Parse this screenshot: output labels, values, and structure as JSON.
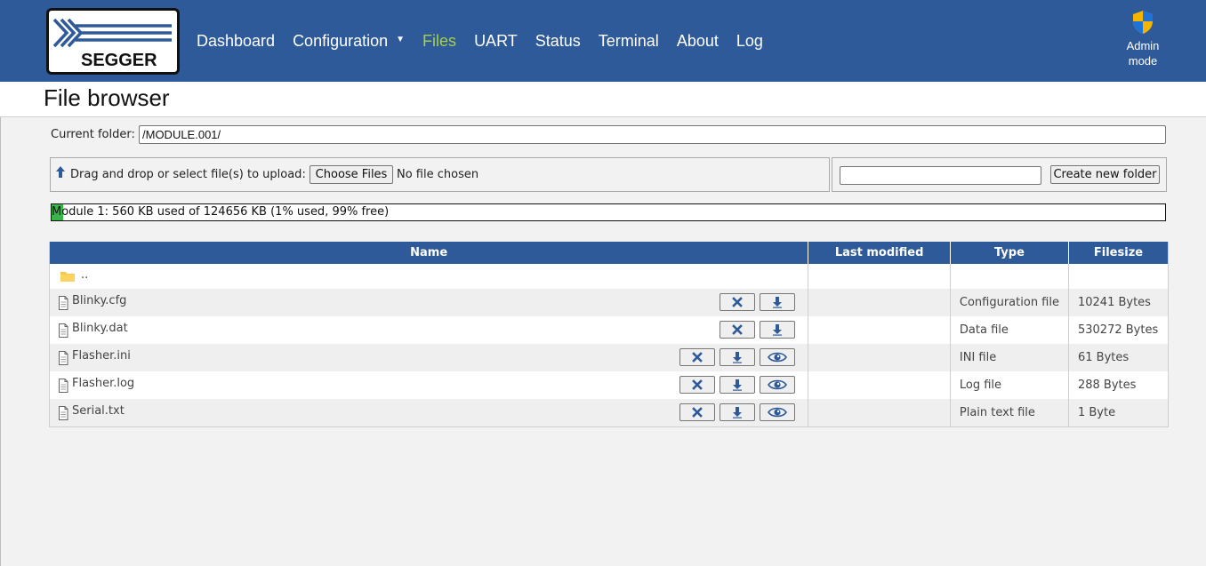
{
  "header": {
    "logo_text": "SEGGER",
    "nav": [
      {
        "label": "Dashboard",
        "active": false
      },
      {
        "label": "Configuration",
        "active": false,
        "has_dropdown": true
      },
      {
        "label": "Files",
        "active": true
      },
      {
        "label": "UART",
        "active": false
      },
      {
        "label": "Status",
        "active": false
      },
      {
        "label": "Terminal",
        "active": false
      },
      {
        "label": "About",
        "active": false
      },
      {
        "label": "Log",
        "active": false
      }
    ],
    "admin_line1": "Admin",
    "admin_line2": "mode",
    "colors": {
      "bar": "#2e5a9a",
      "active_nav": "#a8d046"
    }
  },
  "page": {
    "title": "File browser"
  },
  "current_folder": {
    "label": "Current folder:",
    "value": "/MODULE.001/"
  },
  "upload": {
    "label": "Drag and drop or select file(s) to upload:",
    "choose_label": "Choose Files",
    "no_file": "No file chosen"
  },
  "new_folder": {
    "value": "",
    "button_label": "Create new folder"
  },
  "usage": {
    "text": "Module 1: 560 KB used of 124656 KB (1% used, 99% free)",
    "used_percent": 1
  },
  "table": {
    "headers": {
      "name": "Name",
      "modified": "Last modified",
      "type": "Type",
      "size": "Filesize"
    },
    "up_label": "..",
    "rows": [
      {
        "name": "Blinky.cfg",
        "modified": "",
        "type": "Configuration file",
        "size": "10241 Bytes",
        "actions": [
          "delete",
          "download"
        ]
      },
      {
        "name": "Blinky.dat",
        "modified": "",
        "type": "Data file",
        "size": "530272 Bytes",
        "actions": [
          "delete",
          "download"
        ]
      },
      {
        "name": "Flasher.ini",
        "modified": "",
        "type": "INI file",
        "size": "61 Bytes",
        "actions": [
          "delete",
          "download",
          "view"
        ]
      },
      {
        "name": "Flasher.log",
        "modified": "",
        "type": "Log file",
        "size": "288 Bytes",
        "actions": [
          "delete",
          "download",
          "view"
        ]
      },
      {
        "name": "Serial.txt",
        "modified": "",
        "type": "Plain text file",
        "size": "1 Byte",
        "actions": [
          "delete",
          "download",
          "view"
        ]
      }
    ]
  }
}
